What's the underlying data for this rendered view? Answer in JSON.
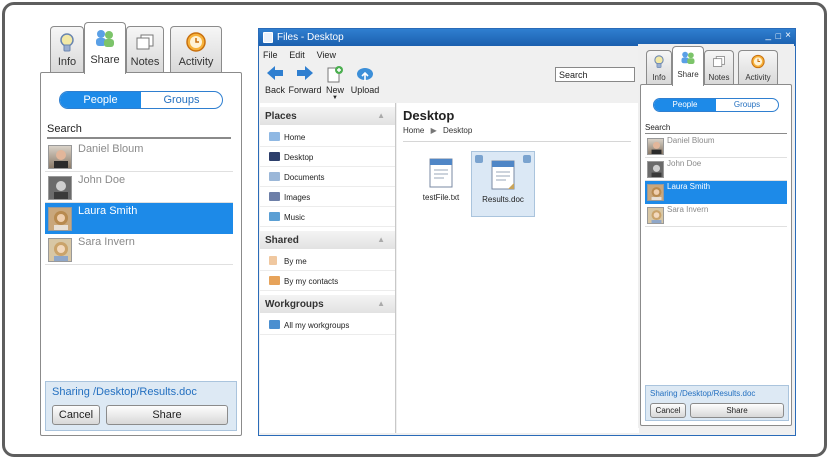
{
  "left_panel": {
    "tabs": [
      {
        "label": "Info",
        "icon": "info-bulb-icon"
      },
      {
        "label": "Share",
        "icon": "share-people-icon"
      },
      {
        "label": "Notes",
        "icon": "notes-icon"
      },
      {
        "label": "Activity",
        "icon": "activity-clock-icon"
      }
    ],
    "segment": {
      "people": "People",
      "groups": "Groups"
    },
    "search_label": "Search",
    "people": [
      {
        "name": "Daniel Bloum",
        "selected": false
      },
      {
        "name": "John Doe",
        "selected": false
      },
      {
        "name": "Laura Smith",
        "selected": true
      },
      {
        "name": "Sara Invern",
        "selected": false
      }
    ],
    "sharing_path": "Sharing /Desktop/Results.doc",
    "cancel_label": "Cancel",
    "share_label": "Share"
  },
  "files_window": {
    "title": "Files - Desktop",
    "title_controls": [
      "_",
      "□",
      "×"
    ],
    "menu": [
      "File",
      "Edit",
      "View"
    ],
    "toolbar": [
      {
        "label": "Back",
        "icon": "back-arrow-icon"
      },
      {
        "label": "Forward",
        "icon": "forward-arrow-icon"
      },
      {
        "label": "New",
        "icon": "new-file-icon"
      },
      {
        "label": "Upload",
        "icon": "upload-cloud-icon"
      }
    ],
    "search_value": "Search",
    "sections": [
      {
        "title": "Places",
        "items": [
          "Home",
          "Desktop",
          "Documents",
          "Images",
          "Music"
        ]
      },
      {
        "title": "Shared",
        "items": [
          "By me",
          "By my contacts"
        ]
      },
      {
        "title": "Workgroups",
        "items": [
          "All my workgroups"
        ]
      }
    ],
    "location_title": "Desktop",
    "breadcrumb": [
      "Home",
      "Desktop"
    ],
    "files": [
      {
        "name": "testFile.txt",
        "selected": false
      },
      {
        "name": "Results.doc",
        "selected": true
      }
    ]
  },
  "right_panel": {
    "tabs": [
      {
        "label": "Info",
        "icon": "info-bulb-icon"
      },
      {
        "label": "Share",
        "icon": "share-people-icon"
      },
      {
        "label": "Notes",
        "icon": "notes-icon"
      },
      {
        "label": "Activity",
        "icon": "activity-clock-icon"
      }
    ],
    "segment": {
      "people": "People",
      "groups": "Groups"
    },
    "search_label": "Search",
    "people": [
      {
        "name": "Daniel Bloum",
        "selected": false
      },
      {
        "name": "John Doe",
        "selected": false
      },
      {
        "name": "Laura Smith",
        "selected": true
      },
      {
        "name": "Sara Invern",
        "selected": false
      }
    ],
    "sharing_path": "Sharing /Desktop/Results.doc",
    "cancel_label": "Cancel",
    "share_label": "Share"
  },
  "colors": {
    "accent": "#1d8ae8",
    "title_bar": "#1b5fae",
    "link_text": "#2470c0"
  }
}
